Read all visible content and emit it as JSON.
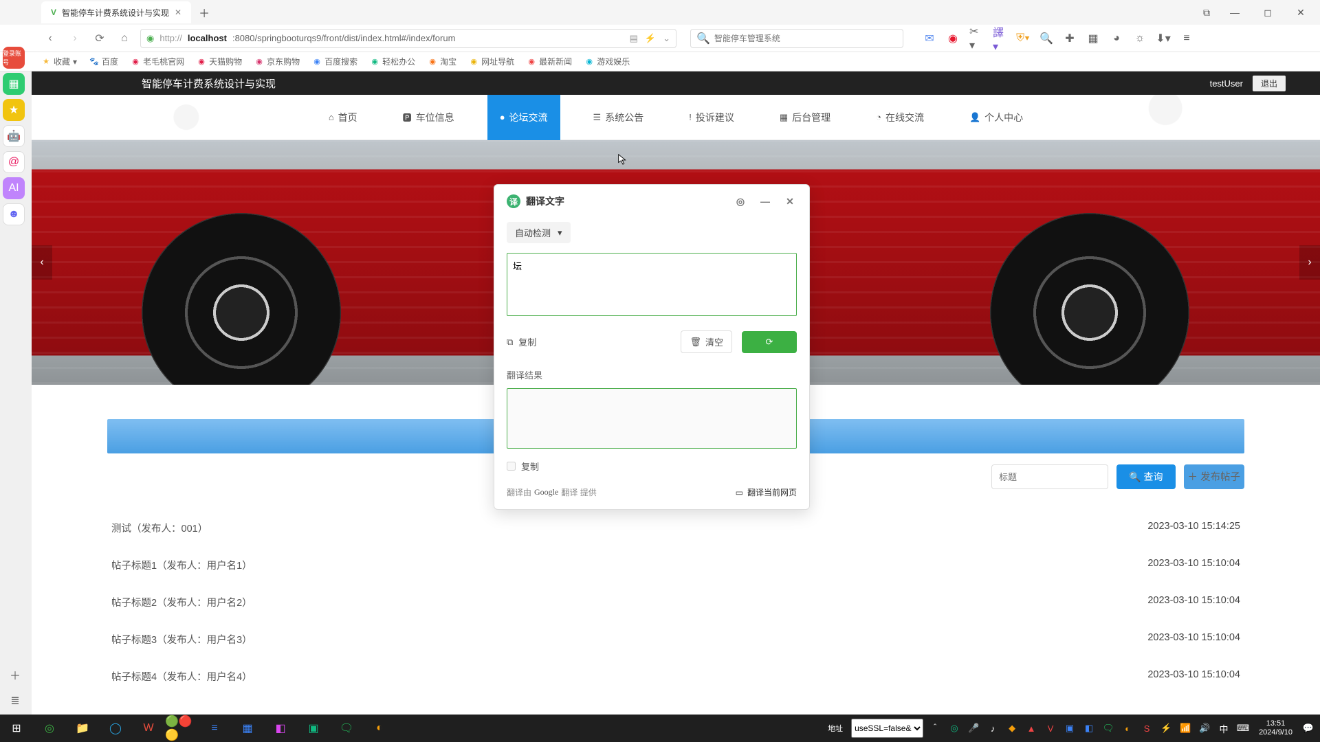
{
  "browser": {
    "tab_title": "智能停车计费系统设计与实现",
    "url": "http://localhost:8080/springbooturqs9/front/dist/index.html#/index/forum",
    "url_display_prefix": "http://",
    "url_display_host": "localhost",
    "url_display_rest": ":8080/springbooturqs9/front/dist/index.html#/index/forum",
    "search_placeholder": "智能停车管理系统",
    "bookmarks_label": "收藏",
    "bookmarks": [
      "百度",
      "老毛桃官网",
      "天猫购物",
      "京东购物",
      "百度搜索",
      "轻松办公",
      "淘宝",
      "网址导航",
      "最新新闻",
      "游戏娱乐"
    ]
  },
  "page": {
    "site_title": "智能停车计费系统设计与实现",
    "username": "testUser",
    "logout": "退出",
    "nav": [
      {
        "icon": "⌂",
        "label": "首页"
      },
      {
        "icon": "🅿",
        "label": "车位信息"
      },
      {
        "icon": "●",
        "label": "论坛交流",
        "active": true
      },
      {
        "icon": "☰",
        "label": "系统公告"
      },
      {
        "icon": "!",
        "label": "投诉建议"
      },
      {
        "icon": "▦",
        "label": "后台管理"
      },
      {
        "icon": "◔",
        "label": "在线交流"
      },
      {
        "icon": "👤",
        "label": "个人中心"
      }
    ],
    "filter_placeholder": "标题",
    "btn_search": "查询",
    "btn_post": "发布帖子",
    "posts": [
      {
        "title": "测试（发布人：001）",
        "ts": "2023-03-10 15:14:25"
      },
      {
        "title": "帖子标题1（发布人：用户名1）",
        "ts": "2023-03-10 15:10:04"
      },
      {
        "title": "帖子标题2（发布人：用户名2）",
        "ts": "2023-03-10 15:10:04"
      },
      {
        "title": "帖子标题3（发布人：用户名3）",
        "ts": "2023-03-10 15:10:04"
      },
      {
        "title": "帖子标题4（发布人：用户名4）",
        "ts": "2023-03-10 15:10:04"
      }
    ]
  },
  "popup": {
    "title": "翻译文字",
    "lang": "自动检测",
    "input_value": "坛",
    "copy": "复制",
    "clear": "清空",
    "result_label": "翻译结果",
    "copy2": "复制",
    "provided_prefix": "翻译由",
    "provided_brand": "Google",
    "provided_brand2": "翻译",
    "provided_suffix": "提供",
    "translate_page": "翻译当前网页"
  },
  "statusbar": {
    "label": "地址",
    "value": "useSSL=false&"
  },
  "clock": {
    "time": "13:51",
    "date": "2024/9/10"
  }
}
